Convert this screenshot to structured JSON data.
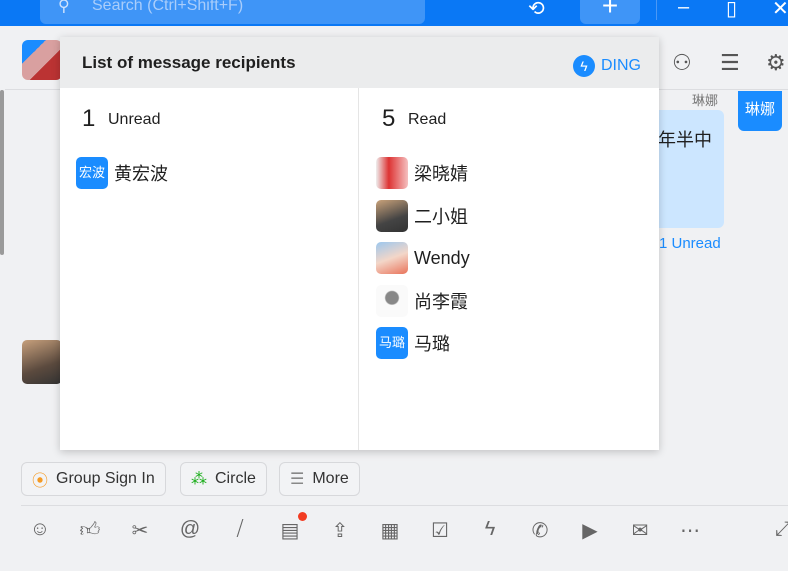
{
  "titlebar": {
    "search_placeholder": "Search (Ctrl+Shift+F)"
  },
  "popup": {
    "title": "List of message recipients",
    "ding_label": "DING",
    "unread": {
      "count": "1",
      "label": "Unread",
      "items": [
        {
          "avatar_text": "宏波",
          "name": "黄宏波"
        }
      ]
    },
    "read": {
      "count": "5",
      "label": "Read",
      "items": [
        {
          "avatar_text": "",
          "name": "梁晓婧"
        },
        {
          "avatar_text": "",
          "name": "二小姐"
        },
        {
          "avatar_text": "",
          "name": "Wendy"
        },
        {
          "avatar_text": "",
          "name": "尚李霞"
        },
        {
          "avatar_text": "马璐",
          "name": "马璐"
        }
      ]
    }
  },
  "chat": {
    "sender_name": "琳娜",
    "sender_avatar_text": "琳娜",
    "bubble_text": "年半中",
    "unread_status": "1 Unread"
  },
  "quick_actions": [
    {
      "label": "Group Sign In",
      "icon": "location-pin-icon",
      "color": "#f59a23"
    },
    {
      "label": "Circle",
      "icon": "circle-icon",
      "color": "#1aad19"
    },
    {
      "label": "More",
      "icon": "menu-icon",
      "color": "#888888"
    }
  ],
  "accent": "#1a8cff"
}
